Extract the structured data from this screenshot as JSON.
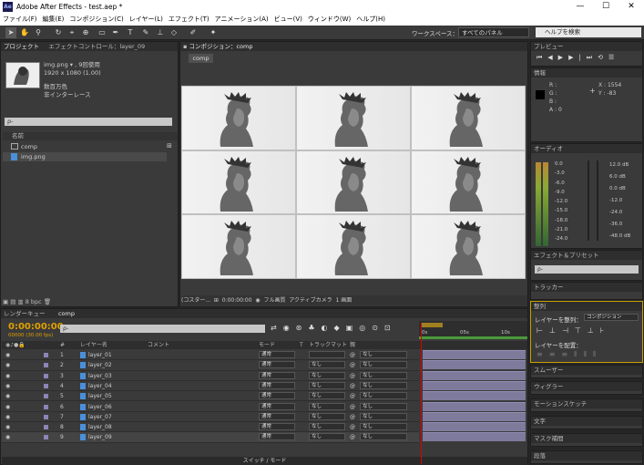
{
  "window": {
    "title": "Adobe After Effects - test.aep *",
    "app_icon": "Ae"
  },
  "menu": [
    "ファイル(F)",
    "編集(E)",
    "コンポジション(C)",
    "レイヤー(L)",
    "エフェクト(T)",
    "アニメーション(A)",
    "ビュー(V)",
    "ウィンドウ(W)",
    "ヘルプ(H)"
  ],
  "toolbar": {
    "workspace_label": "ワークスペース：",
    "workspace_value": "すべてのパネル",
    "help_search": "ヘルプを検索"
  },
  "project": {
    "tab": "プロジェクト",
    "tab2": "エフェクトコントロール：layer_09",
    "asset": {
      "name": "img.png ▾ , 9回使用",
      "size": "1920 x 1080 (1.00)",
      "color": "数百万色",
      "interlace": "非インターレース"
    },
    "search_placeholder": "ρ-",
    "col_name": "名前",
    "items": [
      "comp",
      "img.png"
    ],
    "bpc": "8 bpc"
  },
  "composition": {
    "tab": "コンポジション：comp",
    "chip": "comp",
    "zoom": "(コスター...",
    "timecode": "0:00:00:00",
    "resolution": "フル画質",
    "camera": "アクティブカメラ",
    "view": "1 画面"
  },
  "preview": {
    "title": "プレビュー"
  },
  "info": {
    "title": "情報",
    "r": "R :",
    "g": "G :",
    "b": "B :",
    "a": "A : 0",
    "x": "X : 1554",
    "y": "Y : -83"
  },
  "audio": {
    "title": "オーディオ",
    "left_scale": [
      "0.0",
      "-3.0",
      "-6.0",
      "-9.0",
      "-12.0",
      "-15.0",
      "-18.0",
      "-21.0",
      "-24.0"
    ],
    "right_scale": [
      "12.0 dB",
      "6.0 dB",
      "0.0 dB",
      "-12.0",
      "-24.0",
      "-36.0",
      "-48.0 dB"
    ]
  },
  "effects": {
    "title": "エフェクト＆プリセット",
    "search": "ρ-"
  },
  "tracker": {
    "title": "トラッカー"
  },
  "align": {
    "title": "整列",
    "align_to_label": "レイヤーを整列：",
    "align_to_value": "コンポジション",
    "distribute_label": "レイヤーを配置："
  },
  "panels": [
    "スムーザー",
    "ウィグラー",
    "モーションスケッチ",
    "文字",
    "マスク補間",
    "段落"
  ],
  "timeline": {
    "tab1": "レンダーキュー",
    "tab2": "comp",
    "time": "0:00:00:00",
    "fps": "00000 (30.00 fps)",
    "search": "ρ-",
    "col_num": "#",
    "col_name": "レイヤー名",
    "col_comment": "コメント",
    "col_mode": "モード",
    "col_t": "T",
    "col_trackmatte": "トラックマット",
    "col_parent": "親",
    "switch_mode": "スイッチ / モード",
    "ruler": [
      "0s",
      "05s",
      "10s"
    ],
    "layers": [
      {
        "num": "1",
        "name": "layer_01",
        "mode": "通常",
        "matte": "",
        "parent": "なし"
      },
      {
        "num": "2",
        "name": "layer_02",
        "mode": "通常",
        "matte": "なし",
        "parent": "なし"
      },
      {
        "num": "3",
        "name": "layer_03",
        "mode": "通常",
        "matte": "なし",
        "parent": "なし"
      },
      {
        "num": "4",
        "name": "layer_04",
        "mode": "通常",
        "matte": "なし",
        "parent": "なし"
      },
      {
        "num": "5",
        "name": "layer_05",
        "mode": "通常",
        "matte": "なし",
        "parent": "なし"
      },
      {
        "num": "6",
        "name": "layer_06",
        "mode": "通常",
        "matte": "なし",
        "parent": "なし"
      },
      {
        "num": "7",
        "name": "layer_07",
        "mode": "通常",
        "matte": "なし",
        "parent": "なし"
      },
      {
        "num": "8",
        "name": "layer_08",
        "mode": "通常",
        "matte": "なし",
        "parent": "なし"
      },
      {
        "num": "9",
        "name": "layer_09",
        "mode": "通常",
        "matte": "なし",
        "parent": "なし"
      }
    ]
  }
}
